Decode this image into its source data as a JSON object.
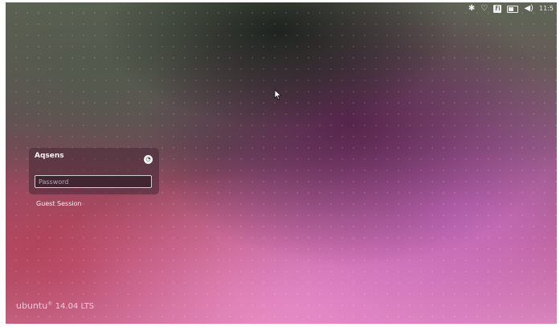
{
  "panel": {
    "icons": [
      "bluetooth-icon",
      "wifi-icon",
      "keyboard-layout-icon",
      "battery-icon",
      "volume-icon"
    ],
    "keyboard_label": "Fi",
    "clock": "11:5"
  },
  "login": {
    "username": "Aqsens",
    "password_placeholder": "Password",
    "guest_label": "Guest Session"
  },
  "branding": {
    "name": "ubuntu",
    "mark": "®",
    "version": "14.04 LTS"
  },
  "colors": {
    "accent": "#dd4814",
    "text": "#f5f5f5"
  }
}
